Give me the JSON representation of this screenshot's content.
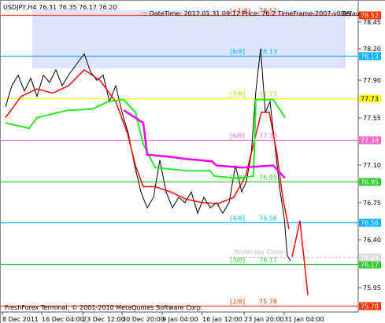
{
  "header": {
    "symbol_line": "USDJPY,H4  76.31 76.35 76.17 76.20",
    "info_line": "::: DateTime: 2012.01.31 09:12    Price: 76.2    TimeFrame-2007-v0.05",
    "corner": "Defau"
  },
  "footer": {
    "copyright": "FreshForex Terminal, © 2001-2010 MetaQuotes Software Corp."
  },
  "colors": {
    "murrey_8_8": "#00b4ff",
    "murrey_plus_1_8": "#ff3300",
    "murrey_7_8": "#ffff00",
    "murrey_6_8": "#ff66cc",
    "murrey_5_8": "#33cc33",
    "murrey_4_8": "#00b4ff",
    "murrey_3_8": "#33cc33",
    "murrey_2_8": "#ff3300",
    "price_line": "#000000",
    "ma_red": "#ff0000",
    "ma_green": "#22ee22",
    "ma_magenta": "#ee00ee",
    "forecast": "#ff0000",
    "shading": "#e0e4fa"
  },
  "levels": [
    {
      "key": "plus_1_8",
      "label": "[+1/8]",
      "value": "78.52",
      "tag": "78.52",
      "tag_bg": "#ff3300",
      "line": "#ff3300"
    },
    {
      "key": "8_8",
      "label": "[8/8]",
      "value": "78.13",
      "tag": "78.13",
      "tag_bg": "#00b4ff",
      "line": "#00b4ff"
    },
    {
      "key": "7_8",
      "label": "[7/8]",
      "value": "77.73",
      "tag": "77.73",
      "tag_bg": "#ffff00",
      "line": "#ffff00"
    },
    {
      "key": "6_8",
      "label": "[6/8]",
      "value": "77.34",
      "tag": "77.34",
      "tag_bg": "#ff66cc",
      "line": "#ff66cc"
    },
    {
      "key": "5_8",
      "label": "[5/8]",
      "value": "76.95",
      "tag": "76.95",
      "tag_bg": "#33cc33",
      "line": "#33cc33"
    },
    {
      "key": "4_8",
      "label": "[4/8]",
      "value": "76.56",
      "tag": "76.56",
      "tag_bg": "#00b4ff",
      "line": "#00b4ff"
    },
    {
      "key": "3_8",
      "label": "[3/8]",
      "value": "76.17",
      "tag": "76.17",
      "tag_bg": "#33cc33",
      "line": "#33cc33"
    },
    {
      "key": "2_8",
      "label": "[2/8]",
      "value": "75.78",
      "tag": "75.78",
      "tag_bg": "#ff3300",
      "line": "#ff3300"
    }
  ],
  "yesterday_close": {
    "label": "Yesterday Close",
    "value": "76.24",
    "tag": "76.24"
  },
  "price_axis_ticks": [
    "78.45",
    "78.20",
    "77.90",
    "77.55",
    "77.10",
    "76.75",
    "76.40",
    "75.95"
  ],
  "time_axis_ticks": [
    "8 Dec 2011",
    "16 Dec 04:00",
    "23 Dec 12:00",
    "30 Dec 20:00",
    "9 Jan 04:00",
    "16 Jan 12:00",
    "23 Jan 20:00",
    "31 Jan 04:00"
  ],
  "chart_data": {
    "type": "line",
    "title": "USDJPY,H4  76.31 76.35 76.17 76.20",
    "xlabel": "",
    "ylabel": "",
    "ylim": [
      75.72,
      78.62
    ],
    "x": [
      "8 Dec 2011",
      "16 Dec 04:00",
      "23 Dec 12:00",
      "30 Dec 20:00",
      "9 Jan 04:00",
      "16 Jan 12:00",
      "23 Jan 20:00",
      "31 Jan 04:00"
    ],
    "series": [
      {
        "values": [
          [
            0,
            77.65
          ],
          [
            8,
            77.85
          ],
          [
            16,
            77.95
          ],
          [
            24,
            77.8
          ],
          [
            32,
            77.92
          ],
          [
            40,
            77.75
          ],
          [
            48,
            77.95
          ],
          [
            56,
            77.88
          ],
          [
            64,
            78.0
          ],
          [
            72,
            77.85
          ],
          [
            80,
            77.95
          ],
          [
            90,
            78.05
          ],
          [
            100,
            78.15
          ],
          [
            108,
            77.98
          ],
          [
            116,
            77.9
          ],
          [
            124,
            77.95
          ],
          [
            132,
            77.7
          ],
          [
            140,
            77.85
          ],
          [
            148,
            77.6
          ],
          [
            156,
            77.4
          ],
          [
            164,
            77.1
          ],
          [
            172,
            76.85
          ],
          [
            180,
            76.7
          ],
          [
            188,
            76.8
          ],
          [
            196,
            77.15
          ],
          [
            204,
            76.85
          ],
          [
            212,
            76.7
          ],
          [
            220,
            76.8
          ],
          [
            228,
            76.75
          ],
          [
            236,
            76.85
          ],
          [
            244,
            76.65
          ],
          [
            252,
            76.8
          ],
          [
            260,
            76.7
          ],
          [
            268,
            76.75
          ],
          [
            276,
            76.65
          ],
          [
            284,
            76.75
          ],
          [
            292,
            77.1
          ],
          [
            300,
            76.85
          ],
          [
            306,
            76.95
          ],
          [
            312,
            77.2
          ],
          [
            318,
            77.8
          ],
          [
            324,
            78.2
          ],
          [
            330,
            77.6
          ],
          [
            336,
            77.7
          ],
          [
            342,
            77.3
          ],
          [
            348,
            76.9
          ],
          [
            354,
            76.6
          ],
          [
            358,
            76.25
          ],
          [
            362,
            76.2
          ]
        ]
      },
      {
        "values": [
          [
            0,
            77.55
          ],
          [
            20,
            77.75
          ],
          [
            40,
            77.82
          ],
          [
            60,
            77.78
          ],
          [
            80,
            77.85
          ],
          [
            100,
            78.0
          ],
          [
            120,
            77.9
          ],
          [
            140,
            77.7
          ],
          [
            155,
            77.4
          ],
          [
            165,
            77.1
          ],
          [
            175,
            76.9
          ],
          [
            190,
            76.9
          ],
          [
            210,
            76.85
          ],
          [
            230,
            76.78
          ],
          [
            250,
            76.75
          ],
          [
            270,
            76.74
          ],
          [
            290,
            76.8
          ],
          [
            305,
            77.0
          ],
          [
            315,
            77.3
          ],
          [
            325,
            77.6
          ],
          [
            335,
            77.6
          ],
          [
            345,
            77.2
          ],
          [
            352,
            76.8
          ],
          [
            360,
            76.5
          ]
        ]
      },
      {
        "values": [
          [
            0,
            77.5
          ],
          [
            30,
            77.45
          ],
          [
            40,
            77.55
          ],
          [
            80,
            77.62
          ],
          [
            110,
            77.63
          ],
          [
            130,
            77.7
          ],
          [
            150,
            77.72
          ],
          [
            165,
            77.6
          ],
          [
            175,
            77.3
          ],
          [
            190,
            77.08
          ],
          [
            230,
            77.05
          ],
          [
            260,
            77.05
          ],
          [
            265,
            77.0
          ],
          [
            295,
            76.98
          ],
          [
            315,
            77.0
          ],
          [
            318,
            77.72
          ],
          [
            340,
            77.72
          ],
          [
            355,
            77.55
          ]
        ]
      },
      {
        "values": [
          [
            150,
            77.62
          ],
          [
            175,
            77.5
          ],
          [
            180,
            77.2
          ],
          [
            210,
            77.18
          ],
          [
            230,
            77.16
          ],
          [
            262,
            77.14
          ],
          [
            268,
            77.1
          ],
          [
            300,
            77.08
          ],
          [
            340,
            77.1
          ],
          [
            355,
            76.98
          ]
        ]
      },
      {
        "values": [
          [
            364,
            76.24
          ],
          [
            374,
            76.58
          ],
          [
            384,
            75.88
          ]
        ]
      }
    ]
  }
}
